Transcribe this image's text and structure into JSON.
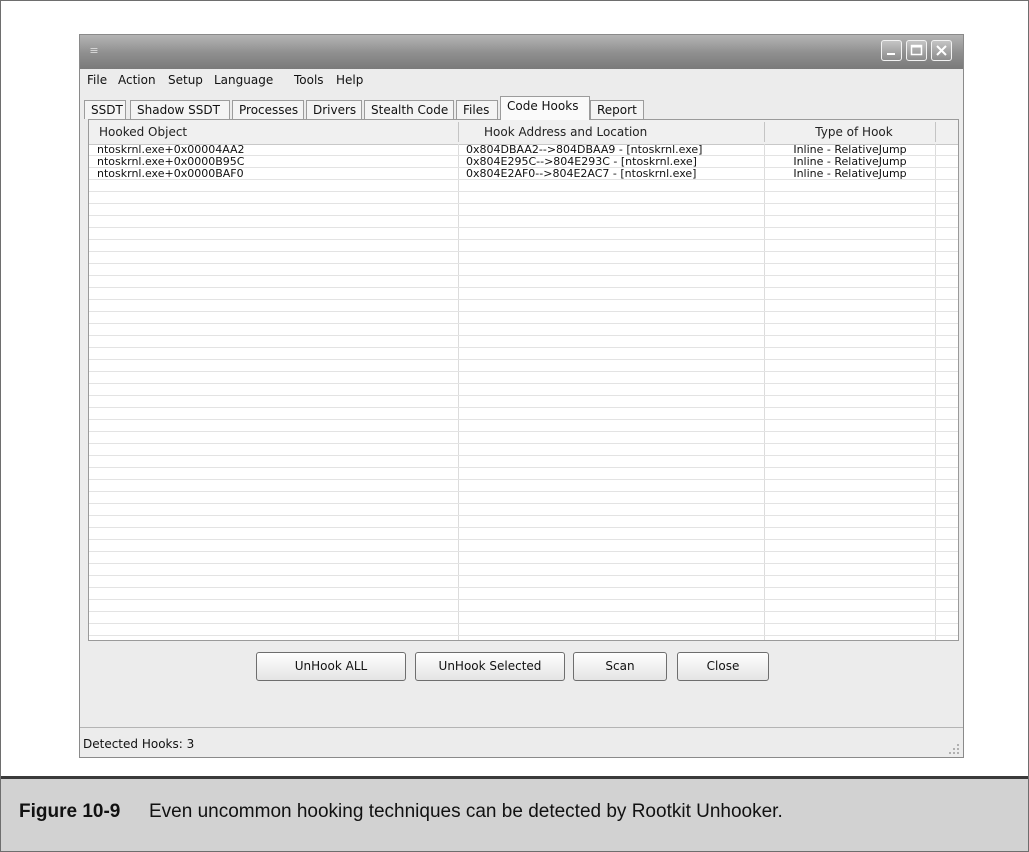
{
  "window": {
    "menu": [
      "File",
      "Action",
      "Setup",
      "Language",
      "Tools",
      "Help"
    ],
    "tabs": [
      "SSDT",
      "Shadow SSDT",
      "Processes",
      "Drivers",
      "Stealth Code",
      "Files",
      "Code Hooks",
      "Report"
    ],
    "active_tab": "Code Hooks",
    "columns": [
      "Hooked Object",
      "Hook Address and Location",
      "Type of Hook"
    ],
    "rows": [
      [
        "ntoskrnl.exe+0x00004AA2",
        "0x804DBAA2-->804DBAA9 - [ntoskrnl.exe]",
        "Inline - RelativeJump"
      ],
      [
        "ntoskrnl.exe+0x0000B95C",
        "0x804E295C-->804E293C - [ntoskrnl.exe]",
        "Inline - RelativeJump"
      ],
      [
        "ntoskrnl.exe+0x0000BAF0",
        "0x804E2AF0-->804E2AC7 - [ntoskrnl.exe]",
        "Inline - RelativeJump"
      ]
    ],
    "buttons": {
      "unhook_all": "UnHook ALL",
      "unhook_selected": "UnHook Selected",
      "scan": "Scan",
      "close": "Close"
    },
    "status": "Detected Hooks: 3"
  },
  "caption": {
    "label": "Figure 10-9",
    "text": "Even uncommon hooking techniques can be detected by Rootkit Unhooker."
  }
}
